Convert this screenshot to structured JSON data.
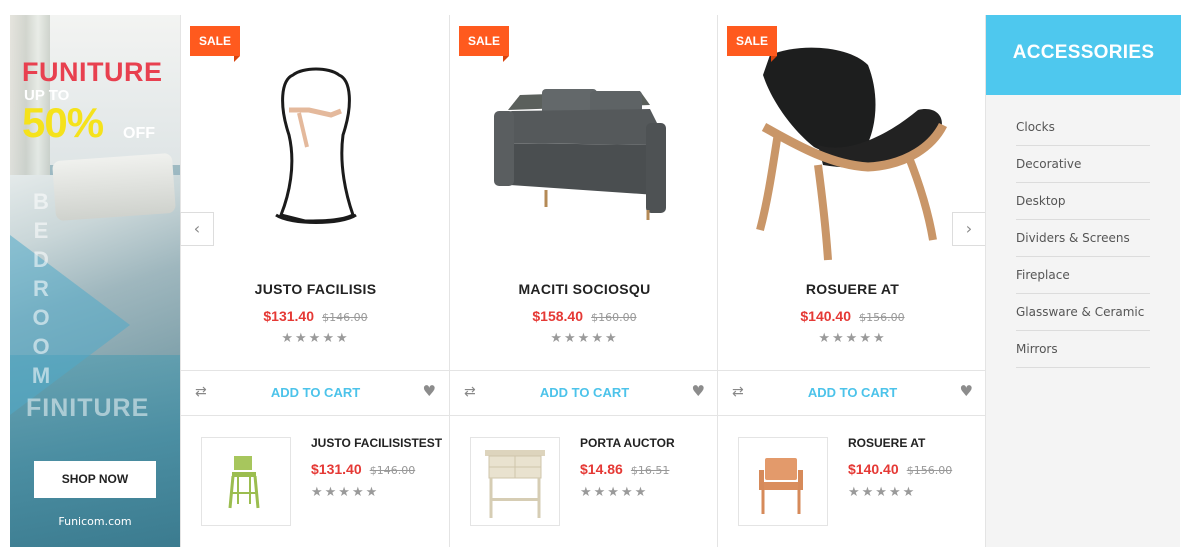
{
  "banner": {
    "title": "FUNITURE",
    "up_to": "UP TO",
    "percent": "50%",
    "off": "OFF",
    "vertical_text": [
      "B",
      "E",
      "D",
      "R",
      "O",
      "O",
      "M"
    ],
    "subtitle": "FINITURE",
    "shop_button": "SHOP NOW",
    "site": "Funicom.com"
  },
  "products": [
    {
      "badge": "SALE",
      "name": "JUSTO FACILISIS",
      "price": "$131.40",
      "old_price": "$146.00",
      "stars": "★★★★★"
    },
    {
      "badge": "SALE",
      "name": "MACITI SOCIOSQU",
      "price": "$158.40",
      "old_price": "$160.00",
      "stars": "★★★★★"
    },
    {
      "badge": "SALE",
      "name": "ROSUERE AT",
      "price": "$140.40",
      "old_price": "$156.00",
      "stars": "★★★★★"
    }
  ],
  "actions": {
    "add_to_cart": "ADD TO CART",
    "compare_icon": "⇄",
    "wishlist_icon": "♥"
  },
  "mini_products": [
    {
      "name": "JUSTO FACILISISTEST",
      "price": "$131.40",
      "old_price": "$146.00",
      "stars": "★★★★★"
    },
    {
      "name": "PORTA AUCTOR",
      "price": "$14.86",
      "old_price": "$16.51",
      "stars": "★★★★★"
    },
    {
      "name": "ROSUERE AT",
      "price": "$140.40",
      "old_price": "$156.00",
      "stars": "★★★★★"
    }
  ],
  "carousel": {
    "prev": "‹",
    "next": "›"
  },
  "accessories": {
    "title": "ACCESSORIES",
    "items": [
      "Clocks",
      "Decorative",
      "Desktop",
      "Dividers & Screens",
      "Fireplace",
      "Glassware & Ceramic",
      "Mirrors"
    ]
  },
  "colors": {
    "sale": "#ff5a1e",
    "price": "#e53935",
    "cart": "#4cc3ea",
    "accent": "#4ec8ee"
  }
}
